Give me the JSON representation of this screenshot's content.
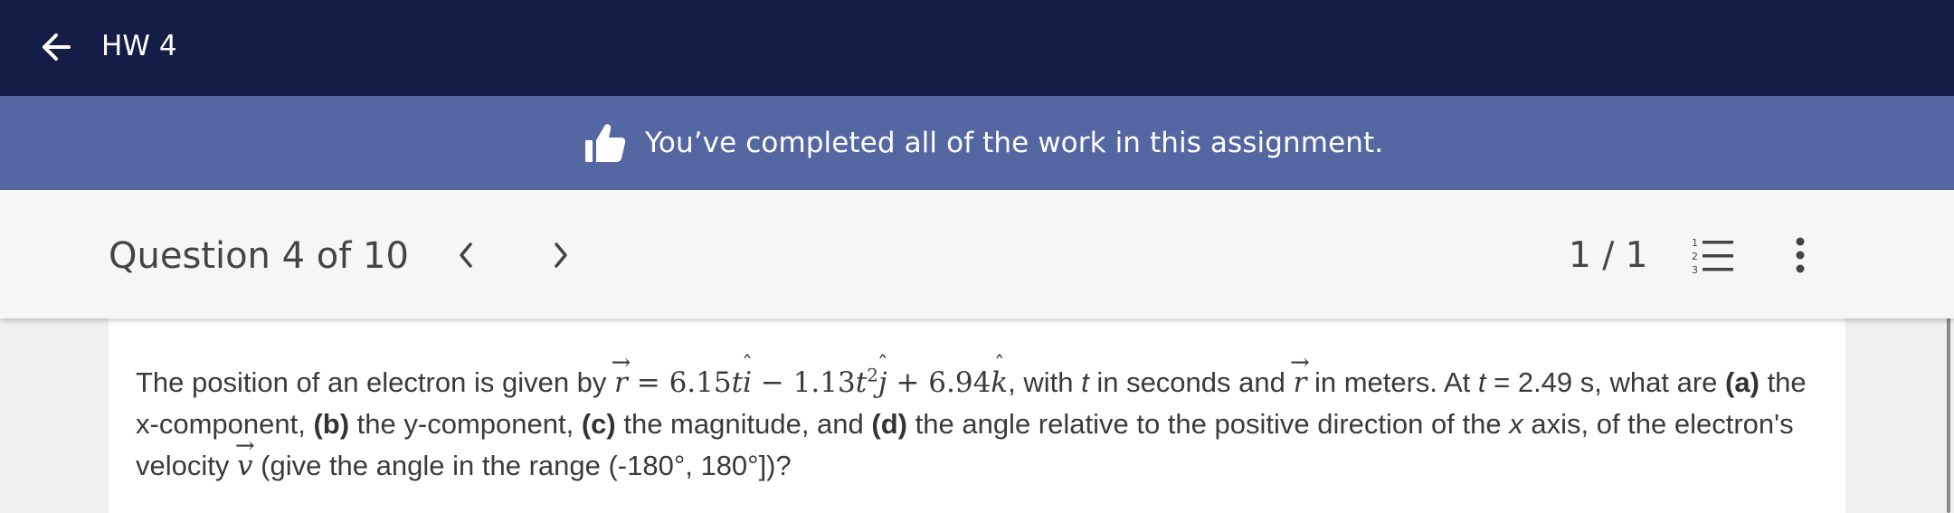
{
  "app": {
    "title": "HW 4"
  },
  "banner": {
    "text": "You’ve completed all of the work in this assignment."
  },
  "question_bar": {
    "title": "Question 4 of 10",
    "score": "1 / 1",
    "prev_icon": "chevron-left-icon",
    "next_icon": "chevron-right-icon",
    "list_icon": "numbered-list-icon",
    "more_icon": "more-vertical-icon"
  },
  "question": {
    "intro": "The position of an electron is given by",
    "r_symbol": "r",
    "eq_sign": "=",
    "c1": "6.15",
    "t1": "t",
    "i_hat": "i",
    "minus": "−",
    "c2": "1.13",
    "t2": "t",
    "exp2": "2",
    "j_hat": "j",
    "plus": "+",
    "c3": "6.94",
    "k_hat": "k",
    "with_text": ", with",
    "t_var": "t",
    "in_seconds": "in seconds and",
    "r_symbol2": "r",
    "in_meters": "in meters. At",
    "t_var2": "t",
    "time_value": "= 2.49 s, what are",
    "label_a": "(a)",
    "text_a": "the x-component,",
    "label_b": "(b)",
    "text_b": "the y-component,",
    "label_c": "(c)",
    "text_c": "the magnitude, and",
    "label_d": "(d)",
    "text_d": "the angle relative to the positive direction of the",
    "x_var": "x",
    "text_e": "axis, of the electron's velocity",
    "v_symbol": "v",
    "text_f": "(give the angle in the range (-180°, 180°])?"
  },
  "colors": {
    "topbar": "#141d46",
    "banner": "#5567a3",
    "question_bar": "#f6f6f6",
    "page_bg": "#efefef",
    "text": "#3a3a3a"
  }
}
